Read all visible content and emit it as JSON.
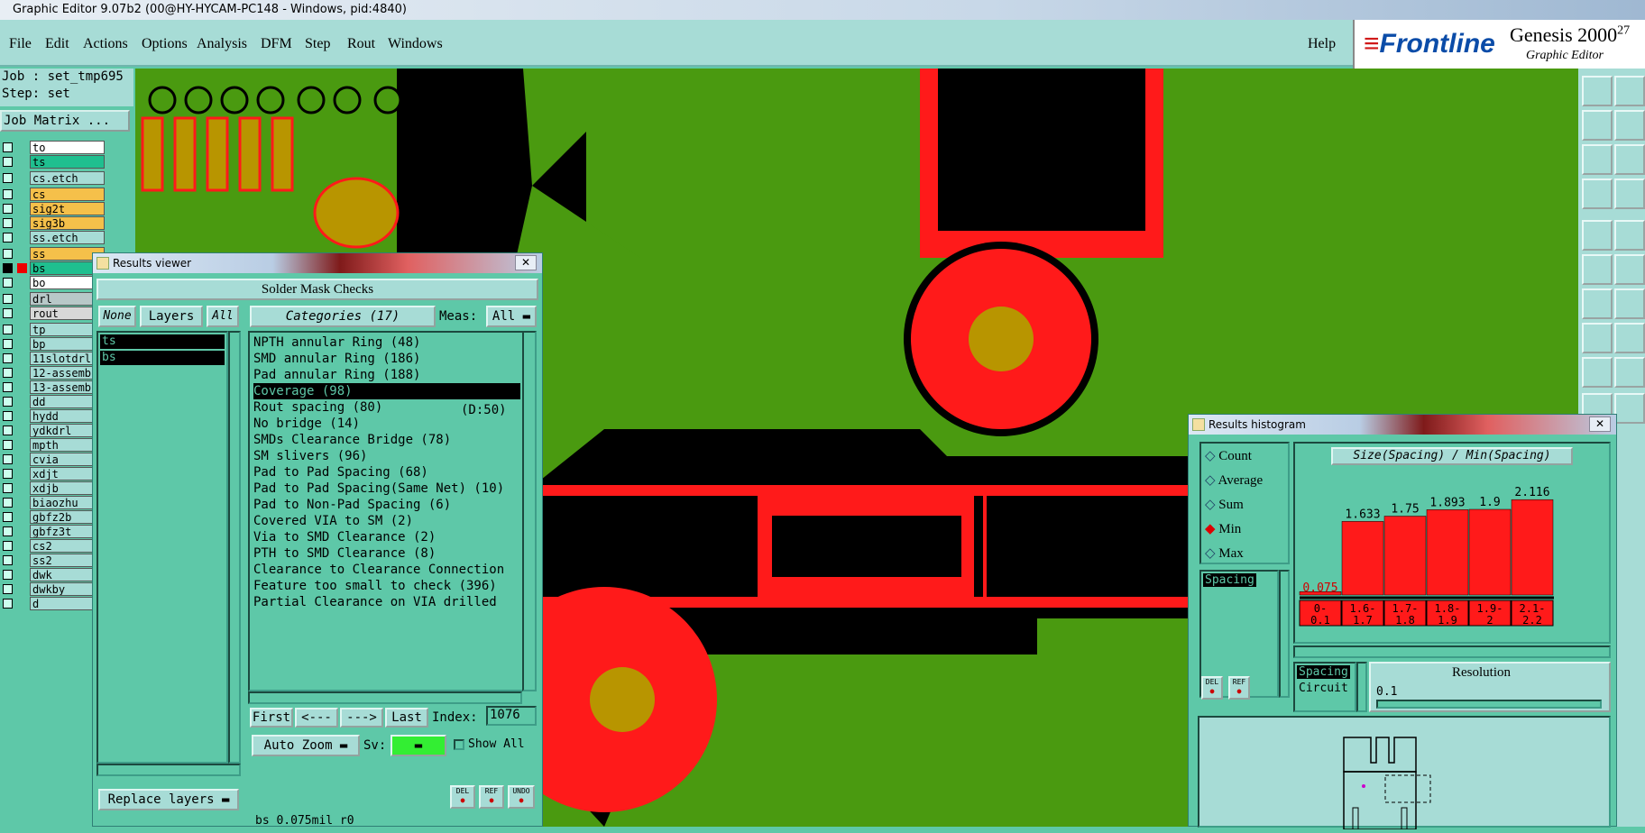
{
  "window": {
    "title": "Graphic Editor 9.07b2 (00@HY-HYCAM-PC148 - Windows, pid:4840)"
  },
  "menu": [
    "File",
    "Edit",
    "Actions",
    "Options",
    "Analysis",
    "DFM",
    "Step",
    "Rout",
    "Windows"
  ],
  "help": "Help",
  "brand": {
    "logo": "Frontline",
    "product": "Genesis 2000",
    "version": "27",
    "subtitle": "Graphic Editor"
  },
  "job": {
    "job_line": "Job : set_tmp695",
    "step_line": "Step: set",
    "matrix_button": "Job Matrix ..."
  },
  "layers": [
    {
      "name": "to",
      "color": "#ffffff"
    },
    {
      "name": "ts",
      "color": "#1fbf8f"
    },
    {
      "name": "cs.etch",
      "color": "#a7dcd6"
    },
    {
      "name": "cs",
      "color": "#f5c04a"
    },
    {
      "name": "sig2t",
      "color": "#f5c04a"
    },
    {
      "name": "sig3b",
      "color": "#f5c04a"
    },
    {
      "name": "ss.etch",
      "color": "#a7dcd6"
    },
    {
      "name": "ss",
      "color": "#f5c04a"
    },
    {
      "name": "bs",
      "color": "#1fbf8f"
    },
    {
      "name": "bo",
      "color": "#ffffff"
    },
    {
      "name": "drl",
      "color": "#b8c8c8"
    },
    {
      "name": "rout",
      "color": "#d8d8d8"
    },
    {
      "name": "tp",
      "color": "#a7dcd6"
    },
    {
      "name": "bp",
      "color": "#a7dcd6"
    },
    {
      "name": "11slotdrl",
      "color": "#a7dcd6"
    },
    {
      "name": "12-assemb",
      "color": "#a7dcd6"
    },
    {
      "name": "13-assemb",
      "color": "#a7dcd6"
    },
    {
      "name": "dd",
      "color": "#a7dcd6"
    },
    {
      "name": "hydd",
      "color": "#a7dcd6"
    },
    {
      "name": "ydkdrl",
      "color": "#a7dcd6"
    },
    {
      "name": "mpth",
      "color": "#a7dcd6"
    },
    {
      "name": "cvia",
      "color": "#a7dcd6"
    },
    {
      "name": "xdjt",
      "color": "#a7dcd6"
    },
    {
      "name": "xdjb",
      "color": "#a7dcd6"
    },
    {
      "name": "biaozhu",
      "color": "#a7dcd6"
    },
    {
      "name": "gbfz2b",
      "color": "#a7dcd6"
    },
    {
      "name": "gbfz3t",
      "color": "#a7dcd6"
    },
    {
      "name": "cs2",
      "color": "#a7dcd6"
    },
    {
      "name": "ss2",
      "color": "#a7dcd6"
    },
    {
      "name": "dwk",
      "color": "#a7dcd6"
    },
    {
      "name": "dwkby",
      "color": "#a7dcd6"
    },
    {
      "name": "d",
      "color": "#a7dcd6"
    }
  ],
  "results_viewer": {
    "title": "Results viewer",
    "header": "Solder Mask Checks",
    "none_btn": "None",
    "layers_btn": "Layers",
    "all_btn": "All",
    "categories_btn": "Categories (17)",
    "meas_label": "Meas:",
    "meas_value": "All",
    "layer_items": [
      "ts",
      "bs"
    ],
    "categories": [
      "NPTH annular Ring (48)",
      "SMD annular Ring (186)",
      "Pad annular Ring (188)",
      "Coverage (98)",
      "Rout spacing (80)",
      "No bridge (14)",
      "SMDs Clearance Bridge (78)",
      "SM slivers (96)",
      "Pad to Pad Spacing (68)",
      "Pad to Pad Spacing(Same Net) (10)",
      "Pad to Non-Pad Spacing (6)",
      "Covered VIA to SM (2)",
      "Via to SMD Clearance (2)",
      "PTH to SMD Clearance (8)",
      "Clearance to Clearance Connection",
      "Feature too small to check (396)",
      "Partial Clearance on VIA drilled"
    ],
    "selected_index": 3,
    "rout_extra": "(D:50)",
    "nav": {
      "first": "First",
      "prev": "<---",
      "next": "--->",
      "last": "Last",
      "index_label": "Index:",
      "index_value": "1076"
    },
    "auto_zoom": "Auto Zoom",
    "sv_label": "Sv:",
    "show_all": "Show All",
    "replace_layers": "Replace layers",
    "icons": [
      "DEL",
      "REF",
      "UNDO"
    ],
    "status": "bs 0.075mil  r0"
  },
  "histogram": {
    "title": "Results histogram",
    "modes": [
      "Count",
      "Average",
      "Sum",
      "Min",
      "Max"
    ],
    "selected_mode": "Min",
    "chart_title": "Size(Spacing) / Min(Spacing)",
    "list_item": "Spacing",
    "icons": [
      "DEL",
      "REF"
    ],
    "lower_list": [
      "Spacing",
      "Circuit"
    ],
    "resolution_label": "Resolution",
    "resolution_value": "0.1",
    "colors": {
      "bar": "#ff1a1a",
      "label_red": "#d00000"
    }
  },
  "chart_data": {
    "type": "bar",
    "title": "Size(Spacing) / Min(Spacing)",
    "categories": [
      "0-\n0.1",
      "1.6-\n1.7",
      "1.7-\n1.8",
      "1.8-\n1.9",
      "1.9-\n2",
      "2.1-\n2.2"
    ],
    "values": [
      0.075,
      1.633,
      1.75,
      1.893,
      1.9,
      2.116
    ],
    "labels": [
      "0.075",
      "1.633",
      "1.75",
      "1.893",
      "1.9",
      "2.116"
    ],
    "ylim": [
      0,
      2.4
    ]
  }
}
